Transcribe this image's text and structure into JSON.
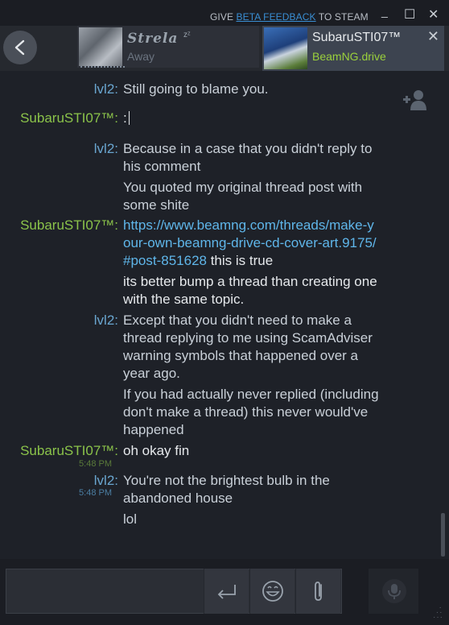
{
  "titlebar": {
    "feedback_pre": "GIVE ",
    "feedback_link": "BETA FEEDBACK",
    "feedback_post": " TO STEAM",
    "minimize": "_",
    "maximize": "☐",
    "close": "✕"
  },
  "tabs": [
    {
      "name": "Strela",
      "status": "Away"
    },
    {
      "name": "SubaruSTI07™",
      "status": "BeamNG.drive",
      "close": "✕"
    }
  ],
  "messages": [
    {
      "sender": "lvl2:",
      "lines": [
        "Still going to blame you."
      ]
    },
    {
      "sender": "SubaruSTI07™:",
      "lines": [
        ":"
      ]
    },
    {
      "sender": "lvl2:",
      "lines": [
        "Because in a case that you didn't reply to his comment",
        "You quoted my original thread post with some shite"
      ]
    },
    {
      "sender": "SubaruSTI07™:",
      "link": "https://www.beamng.com/threads/make-your-own-beamng-drive-cd-cover-art.9175/#post-851628",
      "after_link": " this is true",
      "lines": [
        "its better bump a thread than creating one with the same topic."
      ]
    },
    {
      "sender": "lvl2:",
      "lines": [
        "Except that you didn't need to make a thread replying to me using ScamAdviser warning symbols that happened over a year ago.",
        "If you had actually never replied (including don't make a thread) this never would've happened"
      ]
    },
    {
      "sender": "SubaruSTI07™:",
      "time": "5:48 PM",
      "lines": [
        "oh okay fin"
      ]
    },
    {
      "sender": "lvl2:",
      "time": "5:48 PM",
      "lines": [
        "You're not the brightest bulb in the abandoned house",
        "lol"
      ]
    }
  ],
  "icons": {
    "back": "chevron-left-icon",
    "add_friend": "add-friend-icon",
    "send": "enter-icon",
    "emoji": "emoji-icon",
    "attach": "paperclip-icon",
    "mic": "microphone-icon"
  },
  "colors": {
    "self_name": "#8bc34a",
    "friend_name": "#6aa6d0",
    "link": "#5fb6ea",
    "status_ingame": "#9bd13c"
  }
}
